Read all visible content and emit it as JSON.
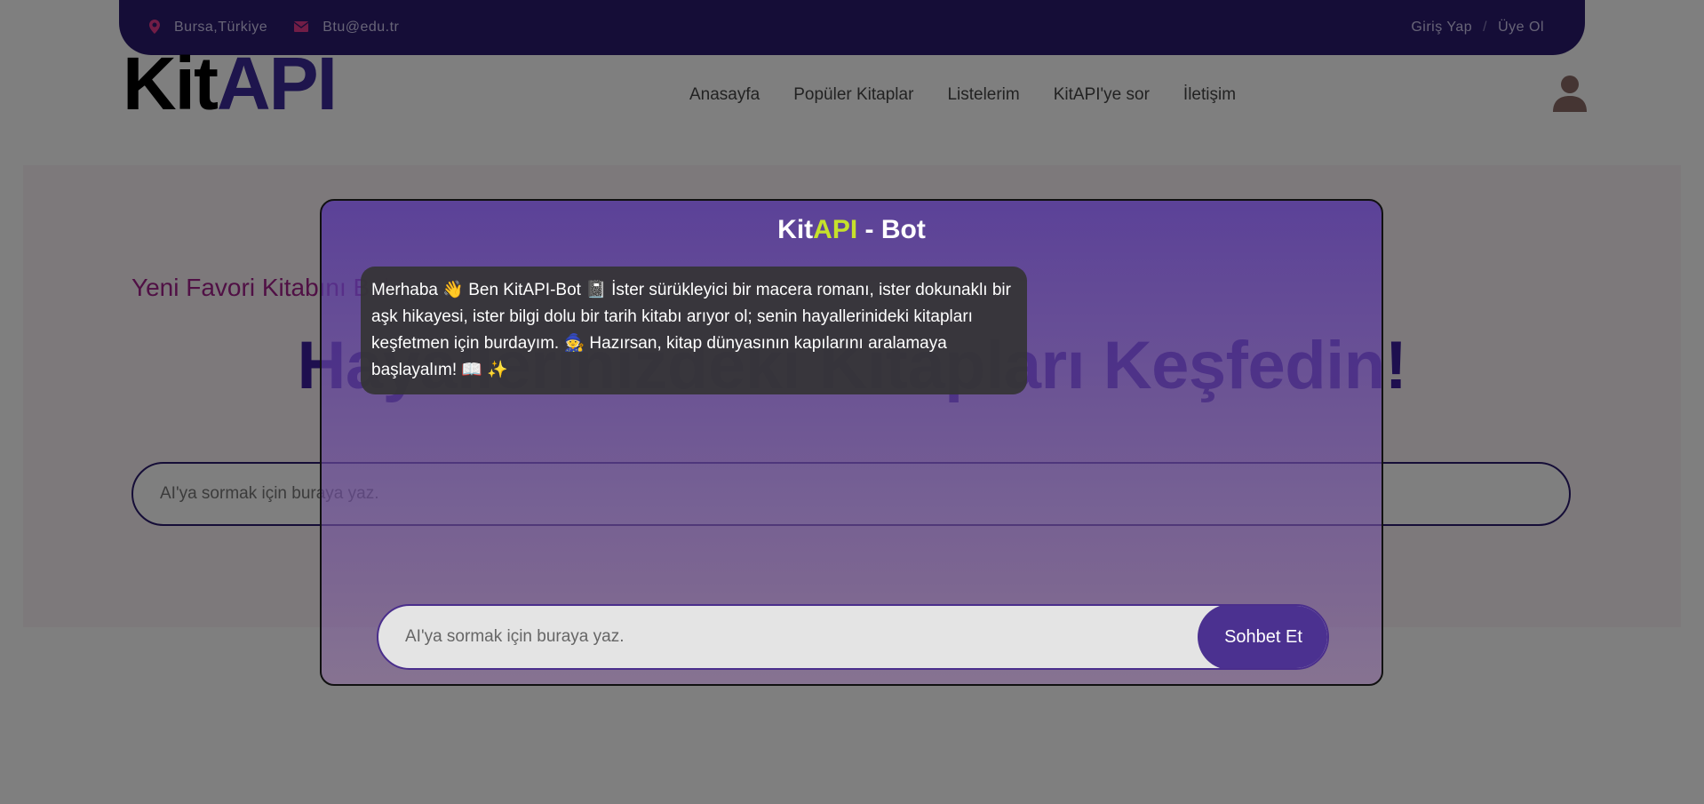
{
  "topbar": {
    "location": "Bursa,Türkiye",
    "email": "Btu@edu.tr",
    "login": "Giriş Yap",
    "separator": "/",
    "signup": "Üye Ol"
  },
  "logo": {
    "part1": "Kit",
    "part2": "API"
  },
  "nav": {
    "items": [
      "Anasayfa",
      "Popüler Kitaplar",
      "Listelerim",
      "KitAPI'ye sor",
      "İletişim"
    ]
  },
  "hero": {
    "subtitle": "Yeni Favori Kitabını Bul",
    "title": "Hayallerinizdeki Kitapları Keşfedin!",
    "search_placeholder": "AI'ya sormak için buraya yaz."
  },
  "chat": {
    "title_part1": "Kit",
    "title_part2": "API",
    "title_part3": " - Bot",
    "message": "Merhaba 👋 Ben KitAPI-Bot 📓 İster sürükleyici bir macera romanı, ister dokunaklı bir aşk hikayesi, ister bilgi dolu bir tarih kitabı arıyor ol; senin hayallerinideki kitapları keşfetmen için burdayım. 🧙 Hazırsan, kitap dünyasının kapılarını aralamaya başlayalım! 📖 ✨",
    "input_placeholder": "AI'ya sormak için buraya yaz.",
    "send_label": "Sohbet Et"
  },
  "colors": {
    "primary": "#2a1a6e",
    "accent": "#c6e12b",
    "pink": "#e23a8c"
  }
}
